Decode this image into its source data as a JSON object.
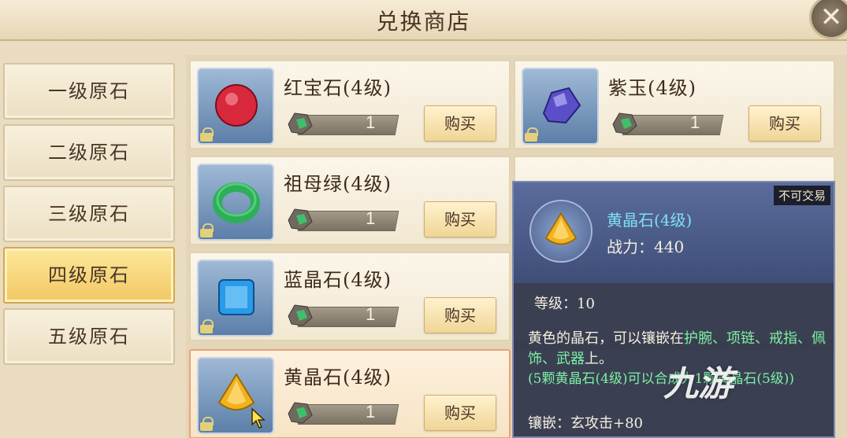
{
  "window": {
    "title": "兑换商店",
    "close_symbol": "✕"
  },
  "sidebar": {
    "items": [
      {
        "label": "一级原石",
        "active": false
      },
      {
        "label": "二级原石",
        "active": false
      },
      {
        "label": "三级原石",
        "active": false
      },
      {
        "label": "四级原石",
        "active": true
      },
      {
        "label": "五级原石",
        "active": false
      }
    ]
  },
  "shop": {
    "items": [
      {
        "name": "红宝石(4级)",
        "price": "1",
        "buy_label": "购买",
        "gem_color": "#d8283c",
        "icon": "ruby-icon"
      },
      {
        "name": "紫玉(4级)",
        "price": "1",
        "buy_label": "购买",
        "gem_color": "#5a4fc8",
        "icon": "purple-jade-icon"
      },
      {
        "name": "祖母绿(4级)",
        "price": "1",
        "buy_label": "购买",
        "gem_color": "#2fae5a",
        "icon": "emerald-icon"
      },
      {
        "name": "蓝晶石(4级)",
        "price": "1",
        "buy_label": "购买",
        "gem_color": "#2a9be8",
        "icon": "kyanite-icon"
      },
      {
        "name": "黄晶石(4级)",
        "price": "1",
        "buy_label": "购买",
        "gem_color": "#f2b21c",
        "icon": "citrine-icon"
      }
    ]
  },
  "tooltip": {
    "badge": "不可交易",
    "name": "黄晶石(4级)",
    "power": "战力：440",
    "level": "等级：10",
    "desc_prefix": "黄色的晶石，可以镶嵌在",
    "desc_slots": "护腕、项链、戒指、佩饰、武器",
    "desc_suffix": "上。",
    "note": "(5颗黄晶石(4级)可以合成为1颗黄晶石(5级))",
    "embed": "镶嵌：玄攻击+80"
  },
  "watermark": "九游"
}
